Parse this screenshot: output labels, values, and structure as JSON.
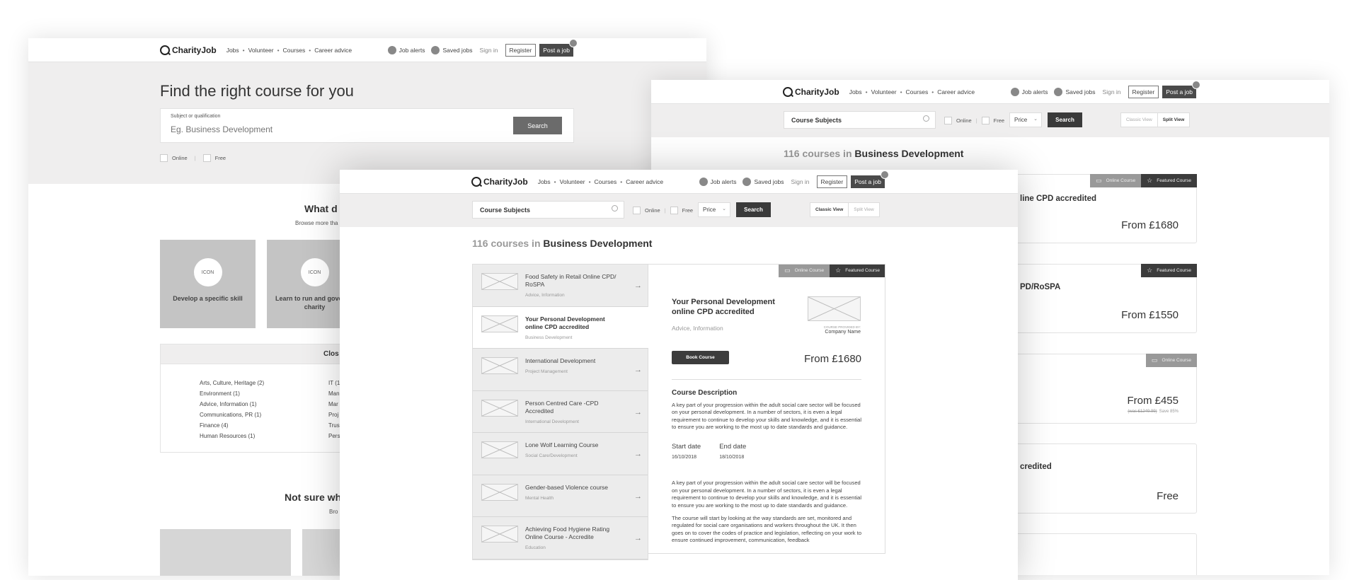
{
  "header": {
    "logo": "CharityJob",
    "nav": [
      "Jobs",
      "Volunteer",
      "Courses",
      "Career advice"
    ],
    "job_alerts": "Job alerts",
    "saved_jobs": "Saved jobs",
    "sign_in": "Sign in",
    "register": "Register",
    "post_job": "Post a job"
  },
  "landing": {
    "title": "Find the right course for you",
    "search_label": "Subject or qualification",
    "search_placeholder": "Eg. Business Development",
    "search_button": "Search",
    "filters": [
      "Online",
      "Free"
    ],
    "section_title": "What d",
    "section_sub": "Browse more tha",
    "icon_text": "ICON",
    "cards": [
      "Develop a specific skill",
      "Learn to run and govern a charity"
    ],
    "close_title": "Clos",
    "categories_col1": [
      "Arts, Culture, Heritage (2)",
      "Environment (1)",
      "Advice, Information (1)",
      "Communications, PR (1)",
      "Finance (4)",
      "Human Resources (1)"
    ],
    "categories_col2": [
      "IT (1",
      "Man",
      "Mar",
      "Proj",
      "Trus",
      "Pers"
    ],
    "section2_title": "Not sure wh",
    "section2_sub": "Bro"
  },
  "search_bar": {
    "input": "Course Subjects",
    "online": "Online",
    "free": "Free",
    "price": "Price",
    "search_button": "Search",
    "classic_view": "Classic View",
    "split_view": "Split View"
  },
  "results": {
    "count": "116 courses in",
    "subject": "Business Development"
  },
  "tags": {
    "online": "Online Course",
    "featured": "Featured Course"
  },
  "classic_cards": [
    {
      "title": "line CPD accredited",
      "price": "From £1680"
    },
    {
      "title": "PD/RoSPA",
      "price": "From £1550"
    },
    {
      "title": "",
      "price": "From £455",
      "was": "(was £1249.99)",
      "save": "Save 85%"
    },
    {
      "title": "credited",
      "price": "Free"
    }
  ],
  "split_list": [
    {
      "title": "Food Safety in Retail Online CPD/ RoSPA",
      "category": "Advice, Information"
    },
    {
      "title": "Your Personal Development online CPD accredited",
      "category": "Business Development"
    },
    {
      "title": "International Development",
      "category": "Project Management"
    },
    {
      "title": "Person Centred Care -CPD Accredited",
      "category": "International Development"
    },
    {
      "title": "Lone Wolf Learning Course",
      "category": "Social Care/Development"
    },
    {
      "title": "Gender-based Violence course",
      "category": "Mental Health"
    },
    {
      "title": "Achieving Food Hygiene Rating Online Course - Accredite",
      "category": "Education"
    }
  ],
  "detail": {
    "title": "Your Personal Development online CPD accredited",
    "category": "Advice, Information",
    "provided_by": "COURSE PROVIDED BY:",
    "company": "Company Name",
    "book": "Book Course",
    "price": "From £1680",
    "desc_heading": "Course Description",
    "desc": "A key part of your progression within the adult social care sector will be focused on your personal development. In a number of sectors, it is even a legal requirement to continue to develop your skills and knowledge, and it is essential to ensure you are working to the most up to date standards and guidance.",
    "start_label": "Start date",
    "start": "16/10/2018",
    "end_label": "End date",
    "end": "18/10/2018",
    "para2": "A key part of your progression within the adult social care sector will be focused on your personal development. In a number of sectors, it is even a legal requirement to continue to develop your skills and knowledge, and it is essential to ensure you are working to the most up to date standards and guidance.",
    "para3": "The course will start by looking at the way standards are set, monitored and regulated for social care organisations and workers throughout the UK. It then goes on to cover the codes of practice and legislation, reflecting on your work to ensure continued improvement, communication, feedback"
  }
}
